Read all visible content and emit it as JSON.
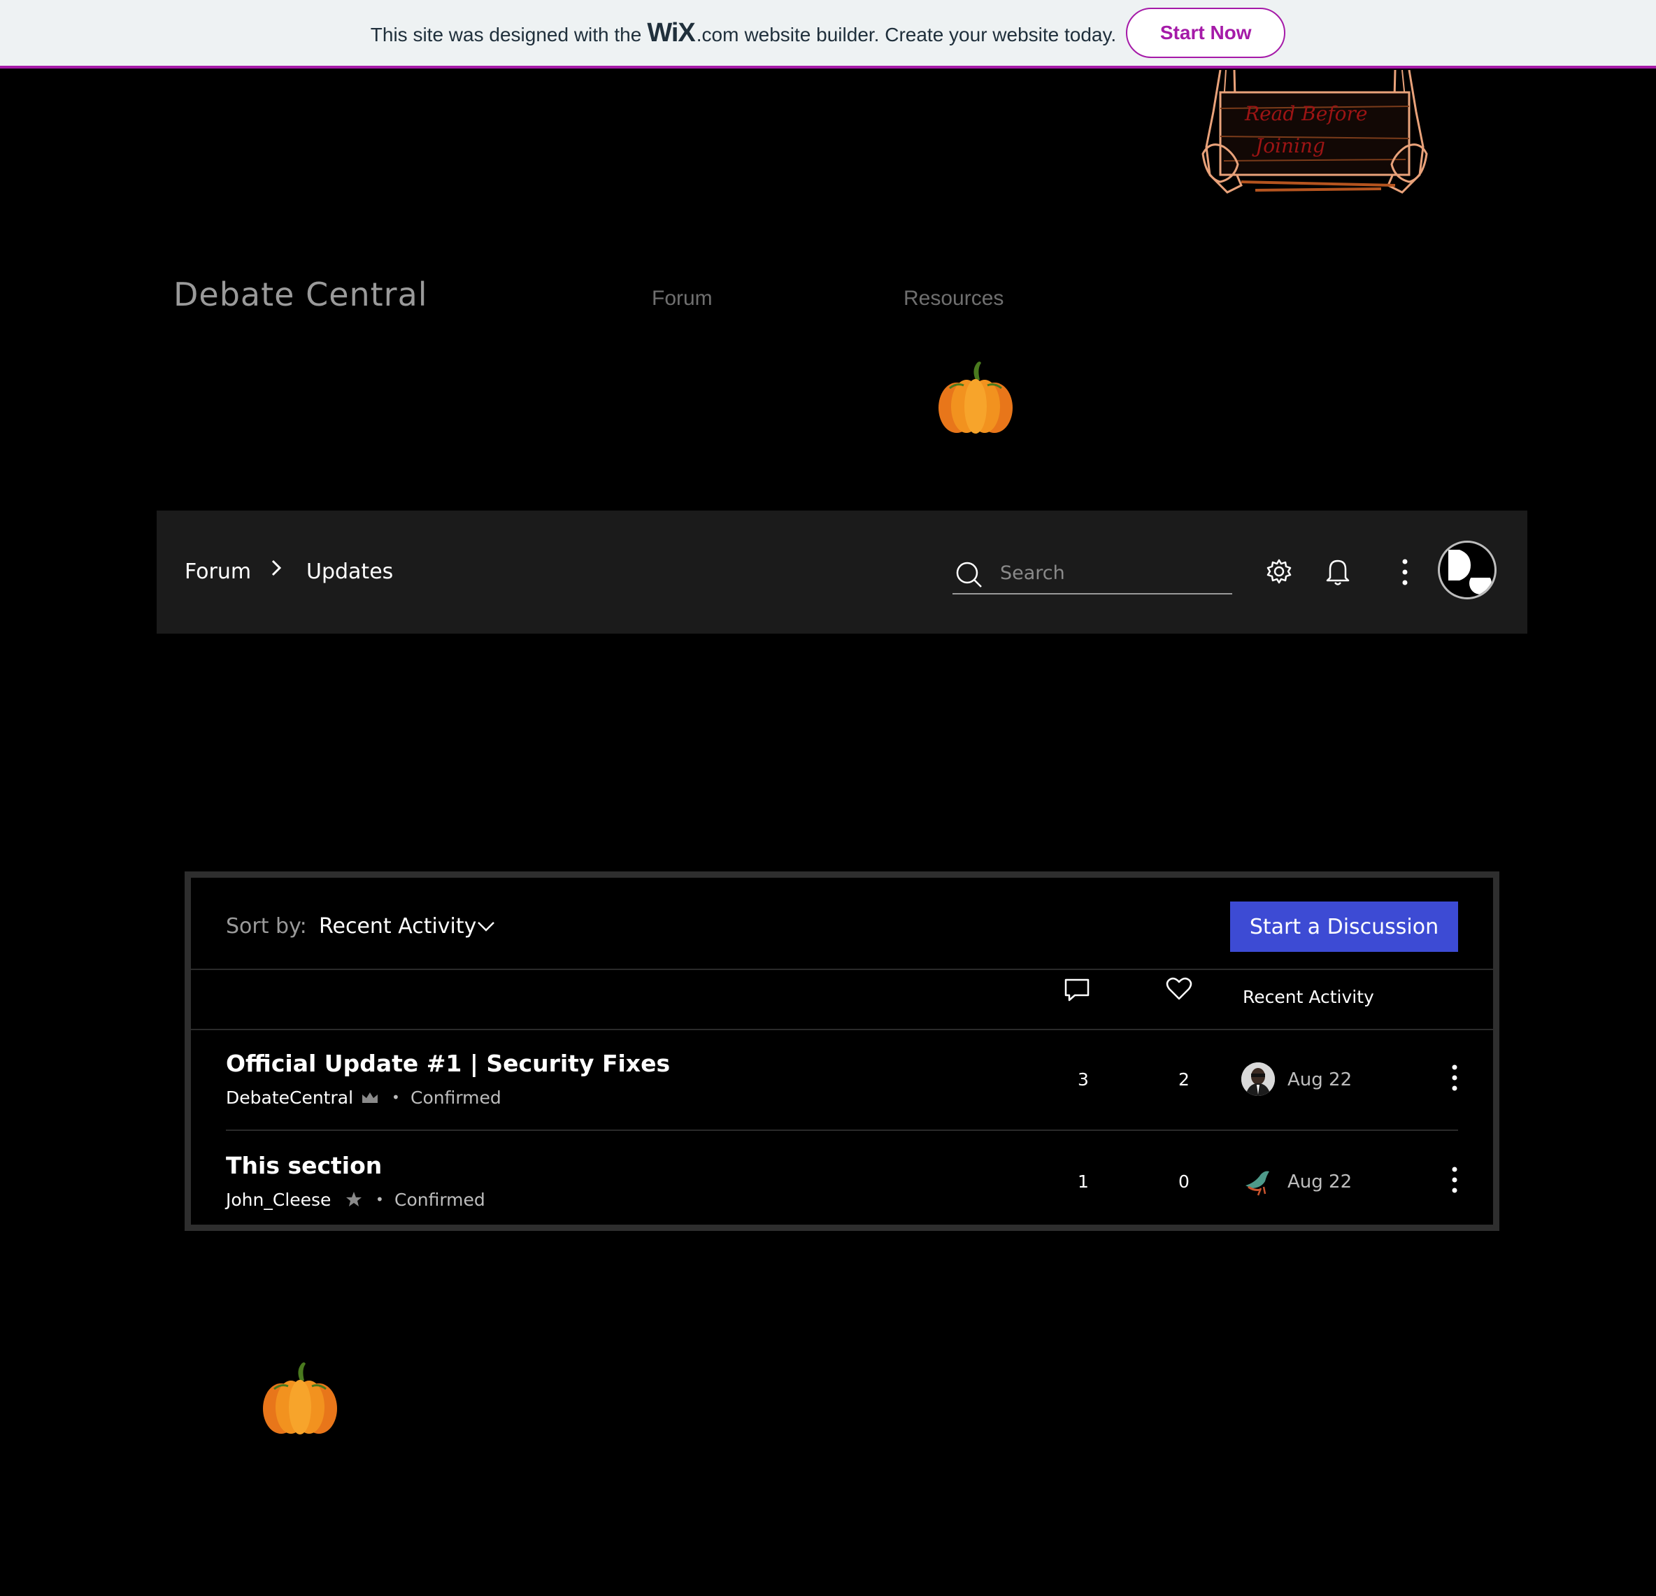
{
  "wix_banner": {
    "text_before": "This site was designed with the",
    "logo": "WiX",
    "logo_suffix": ".com",
    "text_after": "website builder. Create your website today.",
    "cta": "Start Now"
  },
  "header": {
    "sign_text_line1": "Read Before",
    "sign_text_line2": "Joining",
    "site_title": "Debate Central",
    "nav": [
      "Forum",
      "Resources"
    ]
  },
  "forum_bar": {
    "breadcrumb": [
      "Forum",
      "Updates"
    ],
    "search_placeholder": "Search",
    "icons": [
      "settings-icon",
      "notifications-icon",
      "more-icon",
      "avatar"
    ]
  },
  "posts_panel": {
    "sort_label": "Sort by:",
    "sort_value": "Recent Activity",
    "start_button": "Start a Discussion",
    "columns": {
      "comments_icon": "comment-icon",
      "likes_icon": "heart-icon",
      "recent": "Recent Activity"
    },
    "posts": [
      {
        "title": "Official Update #1 | Security Fixes",
        "author": "DebateCentral",
        "badge": "crown-icon",
        "status": "Confirmed",
        "comments": "3",
        "likes": "2",
        "date": "Aug 22"
      },
      {
        "title": "This section",
        "author": "John_Cleese",
        "badge": "star-icon",
        "status": "Confirmed",
        "comments": "1",
        "likes": "0",
        "date": "Aug 22"
      }
    ]
  },
  "colors": {
    "accent": "#a51aa8",
    "button": "#3d4bd4",
    "bar_bg": "#1b1b1b",
    "pumpkin": "#f08a1c"
  }
}
